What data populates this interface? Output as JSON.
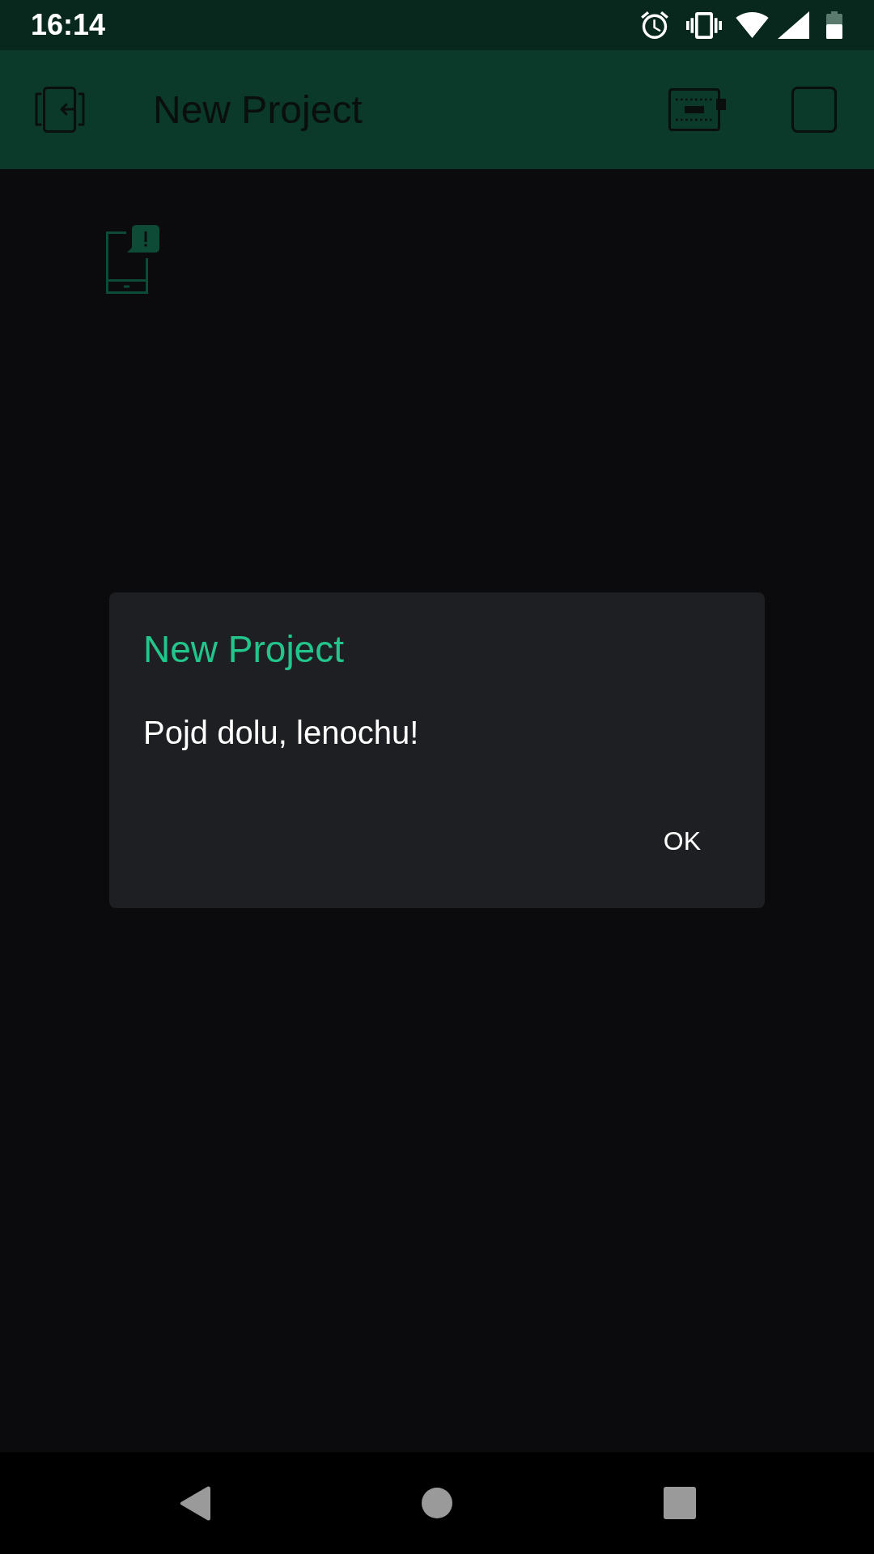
{
  "status_bar": {
    "time": "16:14"
  },
  "app_bar": {
    "title": "New Project"
  },
  "dialog": {
    "title": "New Project",
    "message": "Pojd dolu, lenochu!",
    "buttons": [
      "OK"
    ]
  }
}
